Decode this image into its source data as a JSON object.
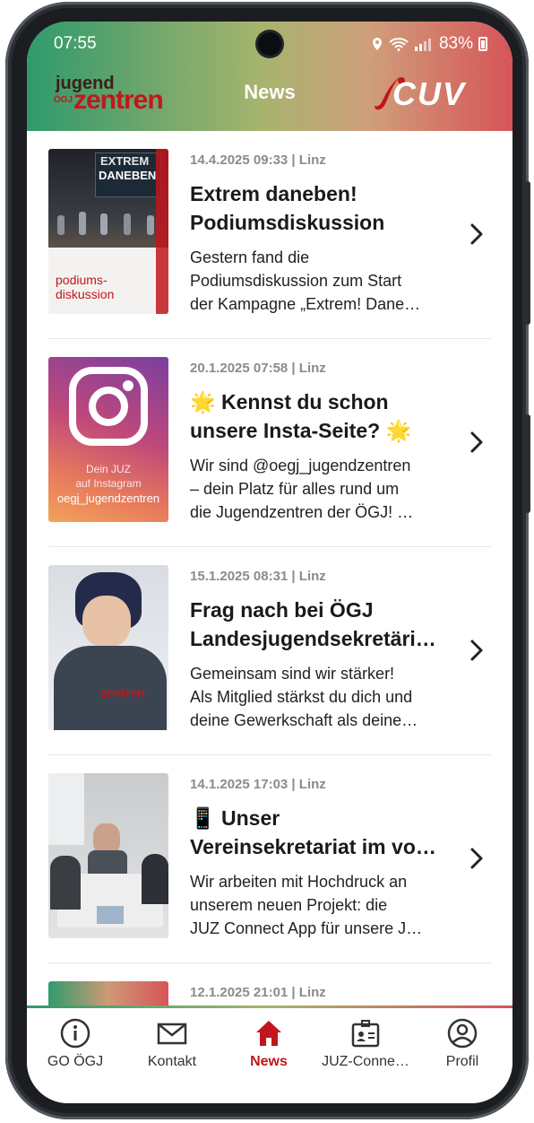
{
  "status": {
    "time": "07:55",
    "battery": "83%"
  },
  "header": {
    "title": "News",
    "logo_left_line1": "jugend",
    "logo_left_small": "ÖGJ",
    "logo_left_line2": "zentren",
    "logo_right": "CUV"
  },
  "news": [
    {
      "meta": "14.4.2025 09:33 | Linz",
      "title_line1": "Extrem daneben!",
      "title_line2": "Podiumsdiskussion",
      "excerpt_line1": "Gestern fand die",
      "excerpt_line2": "Podiumsdiskussion zum Start",
      "excerpt_line3": "der Kampagne „Extrem! Dane…",
      "thumb_text1": "EXTREM",
      "thumb_text2": "DANEBEN",
      "thumb_text3": "podiums-",
      "thumb_text4": "diskussion"
    },
    {
      "meta": "20.1.2025 07:58 | Linz",
      "title_line1": "🌟 Kennst du schon",
      "title_line2": "unsere Insta-Seite? 🌟",
      "excerpt_line1": "Wir sind @oegj_jugendzentren",
      "excerpt_line2": "– dein Platz für alles rund um",
      "excerpt_line3": "die Jugendzentren der ÖGJ! …",
      "thumb_text1": "Dein JUZ",
      "thumb_text2": "auf Instagram",
      "thumb_text3": "oegj_jugendzentren"
    },
    {
      "meta": "15.1.2025 08:31 | Linz",
      "title_line1": "Frag nach bei ÖGJ",
      "title_line2": "Landesjugendsekretäri…",
      "excerpt_line1": "Gemeinsam sind wir stärker!",
      "excerpt_line2": "Als Mitglied stärkst du dich und",
      "excerpt_line3": "deine Gewerkschaft als deine…"
    },
    {
      "meta": "14.1.2025 17:03 | Linz",
      "title_line1": "📱 Unser",
      "title_line2": "Vereinsekretariat im vo…",
      "excerpt_line1": "Wir arbeiten mit Hochdruck an",
      "excerpt_line2": "unserem neuen Projekt: die",
      "excerpt_line3": "JUZ Connect App für unsere J…"
    },
    {
      "meta": "12.1.2025 21:01 | Linz"
    }
  ],
  "tabs": [
    {
      "label": "GO ÖGJ",
      "icon": "info-icon"
    },
    {
      "label": "Kontakt",
      "icon": "mail-icon"
    },
    {
      "label": "News",
      "icon": "home-icon",
      "active": true
    },
    {
      "label": "JUZ-Conne…",
      "icon": "id-card-icon"
    },
    {
      "label": "Profil",
      "icon": "profile-icon"
    }
  ],
  "colors": {
    "accent": "#c0161c",
    "header_green": "#2f9a6c",
    "header_red": "#d65458"
  }
}
